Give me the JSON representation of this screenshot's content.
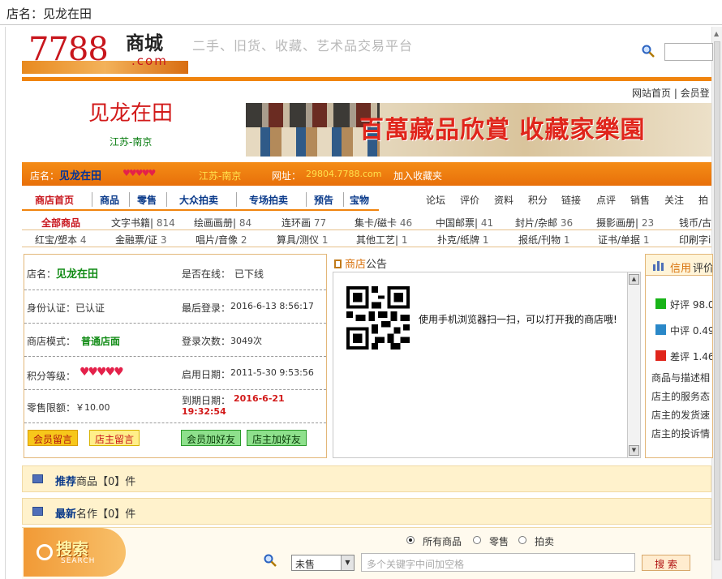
{
  "window": {
    "title": "店名：见龙在田"
  },
  "header": {
    "logo_num": "7788",
    "logo_cn": "商城",
    "logo_com": ".com",
    "slogan": "二手、旧货、收藏、艺术品交易平台",
    "top_links": "网站首页 | 会员登"
  },
  "shop": {
    "name": "见龙在田",
    "location": "江苏-南京",
    "banner_text": "百萬藏品欣賞 收藏家樂園"
  },
  "infobar": {
    "name_label": "店名：",
    "name": "见龙在田",
    "hearts": "♥♥♥♥♥",
    "location": "江苏-南京",
    "url_label": "网址：",
    "url": "29804.7788.com",
    "fav": "加入收藏夹"
  },
  "nav": {
    "left": [
      "商店首页",
      "商品",
      "零售",
      "大众拍卖",
      "专场拍卖",
      "预告",
      "宝物"
    ],
    "right": [
      "论坛",
      "评价",
      "资料",
      "积分",
      "链接",
      "点评",
      "销售",
      "关注",
      "拍"
    ]
  },
  "categories_row1": [
    {
      "name": "全部商品",
      "count": ""
    },
    {
      "name": "文字书籍|",
      "count": "814"
    },
    {
      "name": "绘画画册|",
      "count": "84"
    },
    {
      "name": "连环画",
      "count": "77"
    },
    {
      "name": "集卡/磁卡",
      "count": "46"
    },
    {
      "name": "中国邮票|",
      "count": "41"
    },
    {
      "name": "封片/杂邮",
      "count": "36"
    },
    {
      "name": "摄影画册|",
      "count": "23"
    },
    {
      "name": "钱币/古",
      "count": ""
    }
  ],
  "categories_row2": [
    {
      "name": "红宝/塑本",
      "count": "4"
    },
    {
      "name": "金融票/证",
      "count": "3"
    },
    {
      "name": "唱片/音像",
      "count": "2"
    },
    {
      "name": "算具/测仪",
      "count": "1"
    },
    {
      "name": "其他工艺|",
      "count": "1"
    },
    {
      "name": "扑克/纸牌",
      "count": "1"
    },
    {
      "name": "报纸/刊物",
      "count": "1"
    },
    {
      "name": "证书/单据",
      "count": "1"
    },
    {
      "name": "印刷字i",
      "count": ""
    }
  ],
  "info": {
    "shop_label": "店名：",
    "shop_name": "见龙在田",
    "online_label": "是否在线：",
    "online": "已下线",
    "id_label": "身份认证：",
    "id": "已认证",
    "last_login_label": "最后登录：",
    "last_login": "2016-6-13 8:56:17",
    "mode_label": "商店模式：",
    "mode": "普通店面",
    "login_count_label": "登录次数：",
    "login_count": "3049次",
    "level_label": "积分等级：",
    "level_hearts": "♥♥♥♥♥",
    "start_label": "启用日期：",
    "start": "2011-5-30 9:53:56",
    "limit_label": "零售限额：",
    "limit": "￥10.00",
    "expire_label": "到期日期：",
    "expire_date": "2016-6-21",
    "expire_time": "19:32:54",
    "buttons": [
      "会员留言",
      "店主留言",
      "会员加好友",
      "店主加好友"
    ]
  },
  "notice": {
    "title_a": "商店",
    "title_b": "公告",
    "qr_text": "使用手机浏览器扫一扫，可以打开我的商店哦!"
  },
  "credit": {
    "title_a": "信用",
    "title_b": "评价",
    "good": "好评 98.0",
    "mid": "中评 0.49",
    "bad": "差评 1.46",
    "lines": [
      "商品与描述相",
      "店主的服务态",
      "店主的发货速",
      "店主的投诉情"
    ]
  },
  "recommend": {
    "a": "推荐",
    "b": "商品【0】件"
  },
  "latest": {
    "a": "最新",
    "b": "名作【0】件"
  },
  "search": {
    "logo_cn": "搜索",
    "logo_en": "SEARCH",
    "scope": [
      "所有商品",
      "零售",
      "拍卖"
    ],
    "select": "未售",
    "placeholder": "多个关键字中间加空格",
    "button": "搜 索"
  },
  "colors": {
    "accent": "#f0840e",
    "red": "#d21a1a",
    "green": "#128c16",
    "blue": "#0a3a8a"
  }
}
